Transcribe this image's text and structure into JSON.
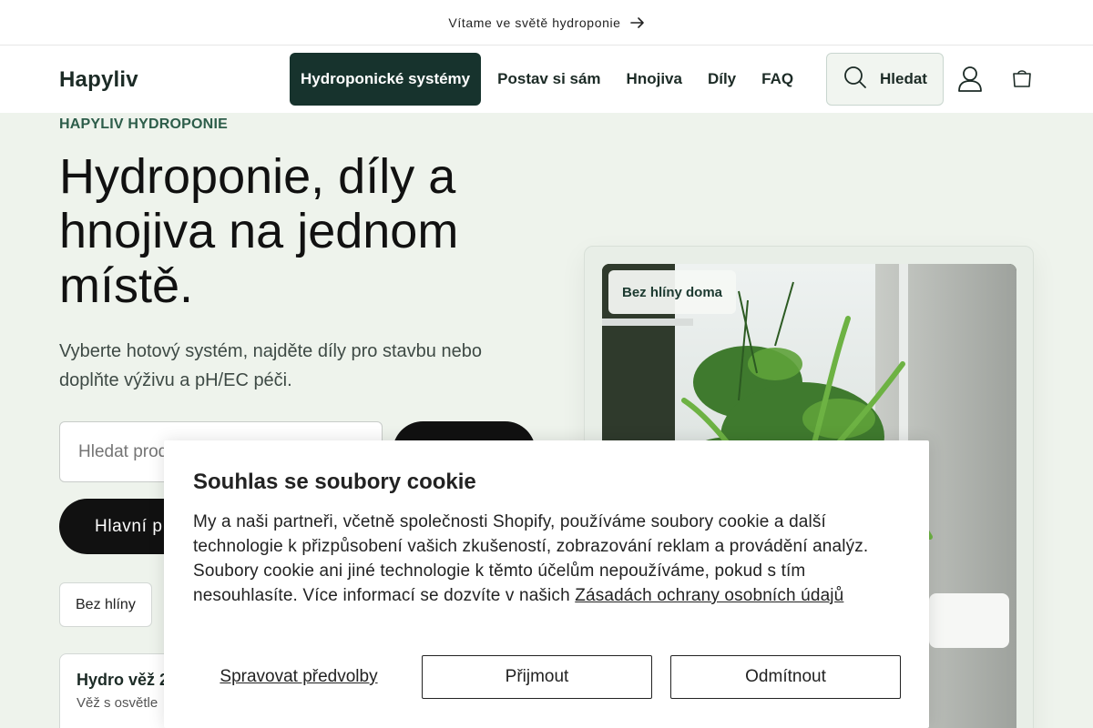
{
  "announcement": {
    "text": "Vítame ve světě hydroponie",
    "icon": "arrow-right-icon"
  },
  "header": {
    "logo": "Hapyliv",
    "nav": [
      {
        "label": "Hydroponické systémy",
        "active": true
      },
      {
        "label": "Postav si sám",
        "active": false
      },
      {
        "label": "Hnojiva",
        "active": false
      },
      {
        "label": "Díly",
        "active": false
      },
      {
        "label": "FAQ",
        "active": false
      }
    ],
    "search_label": "Hledat"
  },
  "hero": {
    "eyebrow": "HAPYLIV HYDROPONIE",
    "title": "Hydroponie, díly a hnojiva na jednom místě.",
    "subtitle": "Vyberte hotový systém, najděte díly pro stavbu nebo doplňte výživu a pH/EC péči.",
    "search_placeholder": "Hledat prod",
    "main_button": "Hlavní p",
    "chip": "Bez hlíny",
    "product_card": {
      "name": "Hydro věž 2",
      "desc": "Věž s osvětle"
    },
    "image_badge": "Bez hlíny doma"
  },
  "cookie": {
    "title": "Souhlas se soubory cookie",
    "text": "My a naši partneři, včetně společnosti Shopify, používáme soubory cookie a další technologie k přizpůsobení vašich zkušeností, zobrazování reklam a provádění analýz. Soubory cookie ani jiné technologie k těmto účelům nepoužíváme, pokud s tím nesouhlasíte. Více informací se dozvíte v našich",
    "link": "Zásadách ochrany osobních údajů",
    "manage": "Spravovat předvolby",
    "accept": "Přijmout",
    "decline": "Odmítnout"
  },
  "colors": {
    "brand_dark": "#17332d",
    "hero_bg": "#eef3ec",
    "eyebrow": "#2d5d4a"
  }
}
